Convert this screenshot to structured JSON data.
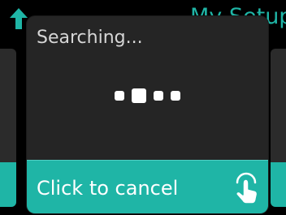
{
  "header": {
    "title": "My Setup",
    "back_icon": "back-arrow-icon",
    "accent_color": "#1fb5a6"
  },
  "dialog": {
    "title": "Searching...",
    "progress_indicator": {
      "dot_count": 4,
      "active_index": 1
    },
    "cancel": {
      "label": "Click to cancel",
      "icon": "touch-hand-icon"
    }
  }
}
